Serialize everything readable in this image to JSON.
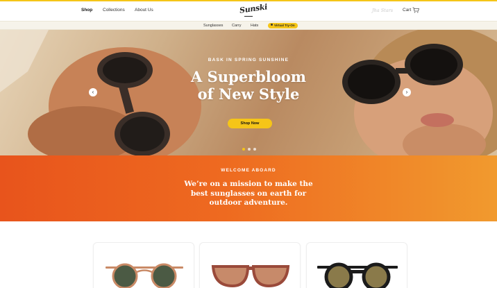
{
  "header": {
    "nav": [
      {
        "label": "Shop",
        "active": true
      },
      {
        "label": "Collections",
        "active": false
      },
      {
        "label": "About Us",
        "active": false
      }
    ],
    "logo": "Sunski",
    "faded_link": "Jha Stars",
    "cart_label": "Cart"
  },
  "subnav": {
    "items": [
      "Sunglasses",
      "Carry",
      "Hats"
    ],
    "tryon_label": "Virtual Try-On"
  },
  "hero": {
    "eyebrow": "BASK IN SPRING SUNSHINE",
    "title_line1": "A Superbloom",
    "title_line2": "of New Style",
    "button": "Shop Now",
    "prev_icon": "chevron-left-icon",
    "next_icon": "chevron-right-icon",
    "slides": 3,
    "active_slide": 1
  },
  "mission": {
    "eyebrow": "WELCOME ABOARD",
    "text": "We’re on a mission to make the best sunglasses on earth for outdoor adventure."
  },
  "products": [
    {
      "frame": "#c98a66",
      "lens": "#4b5a44",
      "name": "round-tortoise-green"
    },
    {
      "frame": "#9a4a3a",
      "lens": "#c78a6a",
      "name": "wayfarer-rose-amber"
    },
    {
      "frame": "#1b1b1b",
      "lens": "#8a7a4a",
      "name": "round-black-gold"
    }
  ],
  "colors": {
    "accent": "#f5c518",
    "mission_start": "#e8541c",
    "mission_end": "#f19a2e"
  }
}
